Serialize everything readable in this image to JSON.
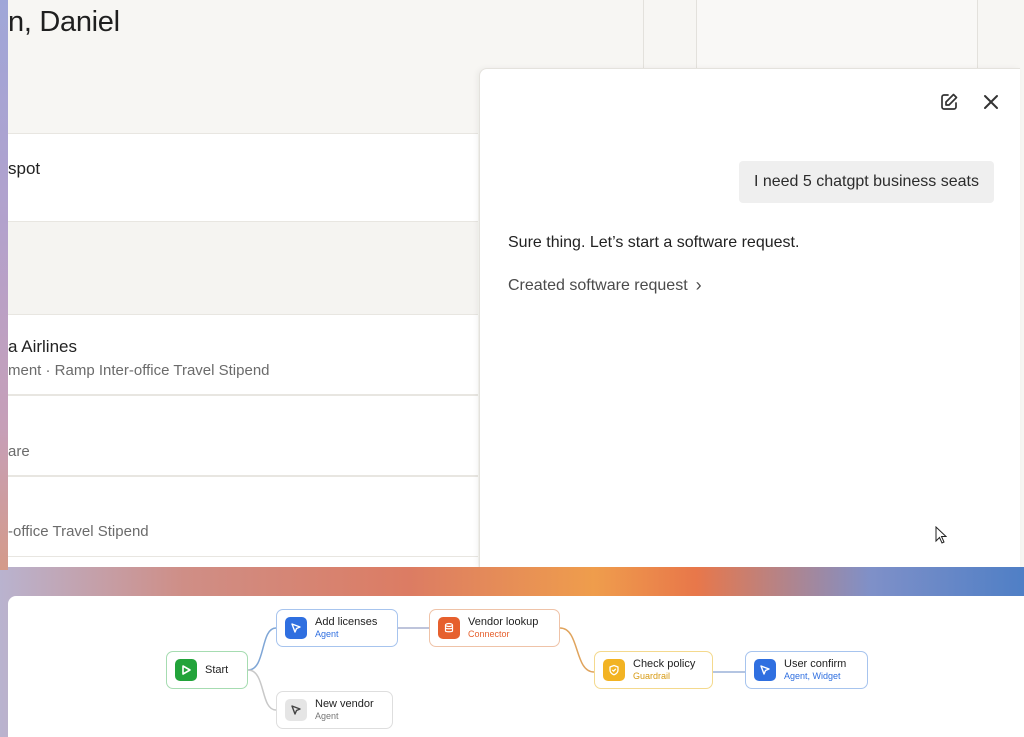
{
  "app": {
    "greeting": "n, Daniel",
    "items": [
      {
        "title": "spot",
        "subtitle": ""
      },
      {
        "title": "a Airlines",
        "subtitle": "ment · Ramp Inter-office Travel Stipend"
      },
      {
        "title": "",
        "subtitle": "are"
      },
      {
        "title": "",
        "subtitle": "-office Travel Stipend"
      }
    ]
  },
  "chat": {
    "icons": {
      "new_chat": "edit-icon",
      "close": "close-icon"
    },
    "user_message": "I need 5 chatgpt business seats",
    "assistant_message": "Sure thing. Let’s start a software request.",
    "created_link": "Created software request",
    "created_chevron": "›"
  },
  "workflow": {
    "nodes": [
      {
        "label": "Start",
        "type": "",
        "color": "#22a33a",
        "icon": "play-icon"
      },
      {
        "label": "Add licenses",
        "type": "Agent",
        "color": "#2f6fe0",
        "icon": "pointer-icon"
      },
      {
        "label": "New vendor",
        "type": "Agent",
        "color": "#e5e5e5",
        "icon": "pointer-icon"
      },
      {
        "label": "Vendor lookup",
        "type": "Connector",
        "color": "#e6602e",
        "icon": "database-icon"
      },
      {
        "label": "Check policy",
        "type": "Guardrail",
        "color": "#f2b323",
        "icon": "shield-icon"
      },
      {
        "label": "User confirm",
        "type": "Agent, Widget",
        "color": "#2f6fe0",
        "icon": "pointer-icon"
      }
    ]
  }
}
